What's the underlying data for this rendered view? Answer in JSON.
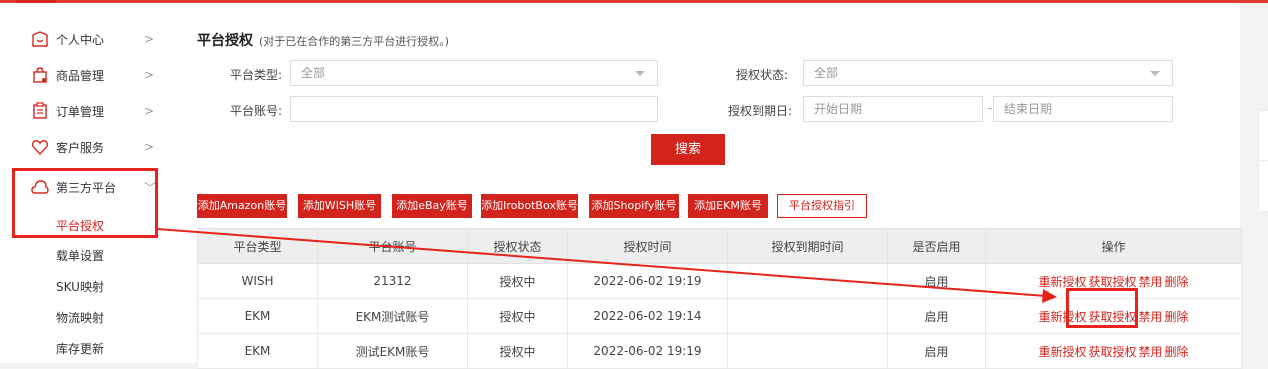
{
  "sidebar": {
    "items": [
      {
        "label": "个人中心",
        "arrow": ">",
        "icon": "user-center-icon"
      },
      {
        "label": "商品管理",
        "arrow": ">",
        "icon": "goods-bag-icon"
      },
      {
        "label": "订单管理",
        "arrow": ">",
        "icon": "order-clipboard-icon"
      },
      {
        "label": "客户服务",
        "arrow": ">",
        "icon": "heart-icon"
      },
      {
        "label": "第三方平台",
        "arrow": "﹀",
        "icon": "cloud-icon"
      }
    ],
    "subitems": [
      "平台授权",
      "载单设置",
      "SKU映射",
      "物流映射",
      "库存更新"
    ]
  },
  "main": {
    "title": "平台授权",
    "subtitle": "(对于已在合作的第三方平台进行授权。)",
    "filters": {
      "platform_type_label": "平台类型:",
      "platform_type_value": "全部",
      "auth_status_label": "授权状态:",
      "auth_status_value": "全部",
      "platform_account_label": "平台账号:",
      "platform_account_value": "",
      "expiry_label": "授权到期日:",
      "start_date_placeholder": "开始日期",
      "date_separator": "-",
      "end_date_placeholder": "结束日期"
    },
    "search_label": "搜索",
    "add_buttons": [
      "添加Amazon账号",
      "添加WISH账号",
      "添加eBay账号",
      "添加IrobotBox账号",
      "添加Shopify账号",
      "添加EKM账号"
    ],
    "guide_button": "平台授权指引",
    "table": {
      "headers": [
        "平台类型",
        "平台账号",
        "授权状态",
        "授权时间",
        "授权到期时间",
        "是否启用",
        "操作"
      ],
      "rows": [
        {
          "type": "WISH",
          "account": "21312",
          "status": "授权中",
          "time": "2022-06-02 19:19",
          "expiry": "",
          "enabled": "启用"
        },
        {
          "type": "EKM",
          "account": "EKM测试账号",
          "status": "授权中",
          "time": "2022-06-02 19:14",
          "expiry": "",
          "enabled": "启用"
        },
        {
          "type": "EKM",
          "account": "测试EKM账号",
          "status": "授权中",
          "time": "2022-06-02 19:19",
          "expiry": "",
          "enabled": "启用"
        }
      ],
      "actions": [
        "重新授权",
        "获取授权",
        "禁用",
        "删除"
      ]
    }
  },
  "colors": {
    "accent": "#d2231c",
    "highlight": "#e6241c"
  }
}
